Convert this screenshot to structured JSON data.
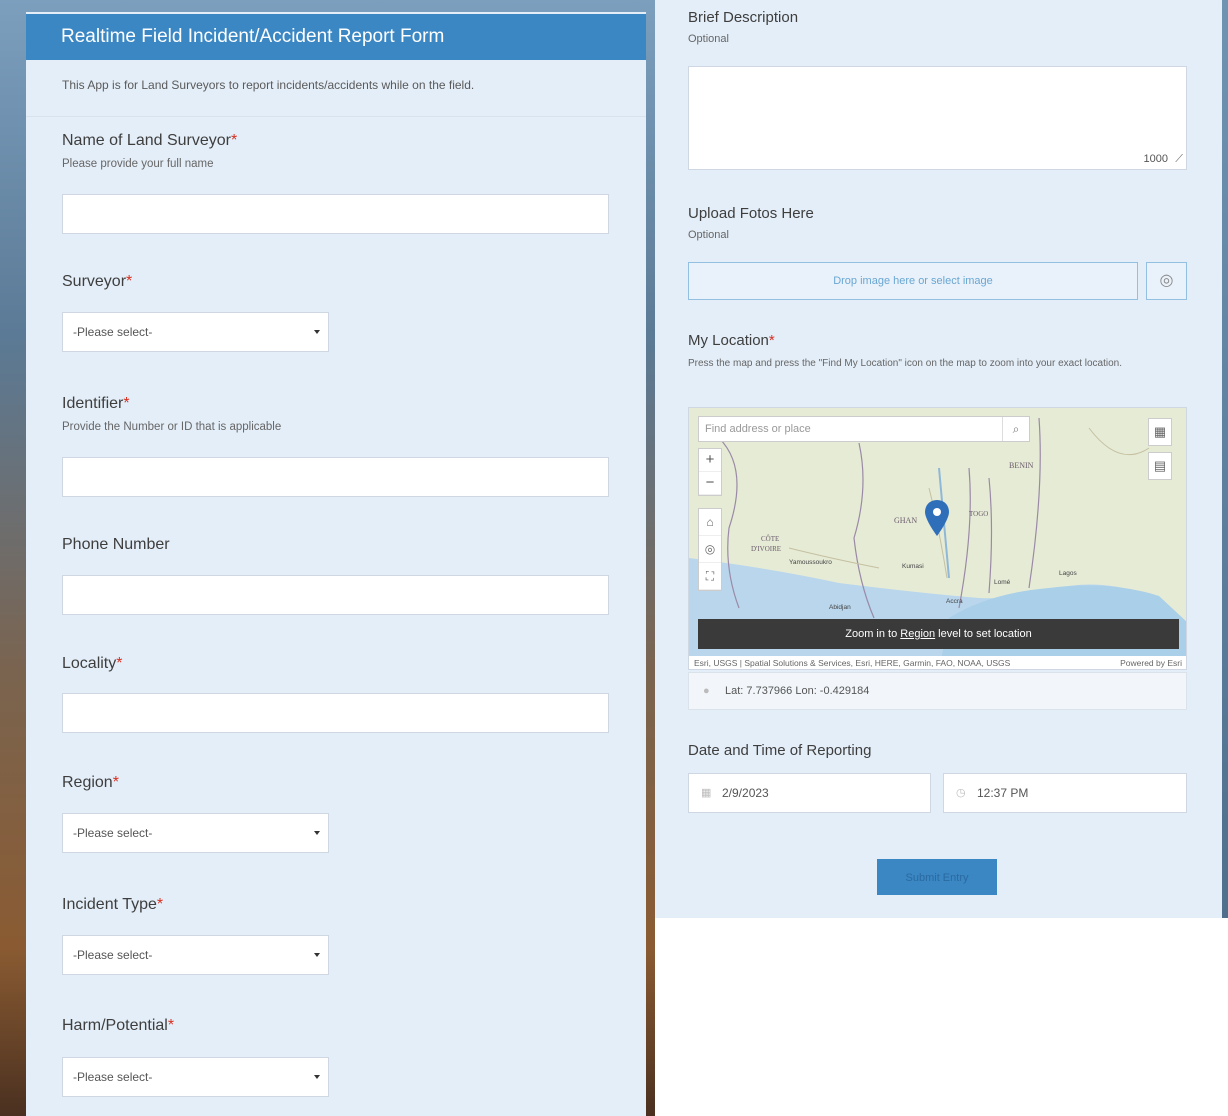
{
  "form": {
    "title": "Realtime Field Incident/Accident Report Form",
    "description": "This App is for Land Surveyors to report incidents/accidents while on the field."
  },
  "fields": {
    "name": {
      "label": "Name of Land Surveyor",
      "required": "*",
      "hint": "Please provide your full name",
      "value": ""
    },
    "surveyor": {
      "label": "Surveyor",
      "required": "*",
      "selected": "-Please select-"
    },
    "identifier": {
      "label": "Identifier",
      "required": "*",
      "hint": "Provide the Number or ID that is applicable",
      "value": ""
    },
    "phone": {
      "label": "Phone Number",
      "value": ""
    },
    "locality": {
      "label": "Locality",
      "required": "*",
      "value": ""
    },
    "region": {
      "label": "Region",
      "required": "*",
      "selected": "-Please select-"
    },
    "incident_type": {
      "label": "Incident Type",
      "required": "*",
      "selected": "-Please select-"
    },
    "harm": {
      "label": "Harm/Potential",
      "required": "*",
      "selected": "-Please select-"
    },
    "description": {
      "label": "Brief Description",
      "hint": "Optional",
      "counter": "1000"
    },
    "photos": {
      "label": "Upload Fotos Here",
      "hint": "Optional",
      "dropzone": "Drop image here or select image"
    },
    "location": {
      "label": "My Location",
      "required": "*",
      "hint": "Press the map and press the \"Find My Location\" icon on the map to zoom into your exact location.",
      "search_placeholder": "Find address or place",
      "banner_pre": "Zoom in to ",
      "banner_link": "Region",
      "banner_post": " level to set location",
      "attribution_left": "Esri, USGS | Spatial Solutions & Services, Esri, HERE, Garmin, FAO, NOAA, USGS",
      "attribution_right": "Powered by Esri",
      "coords": "Lat: 7.737966  Lon: -0.429184",
      "map_labels": {
        "benin": "BENIN",
        "togo": "TOGO",
        "ghana": "GHAN",
        "cote": "CÔTE",
        "divoire": "D'IVOIRE",
        "yamoussoukro": "Yamoussoukro",
        "kumasi": "Kumasi",
        "lome": "Lomé",
        "lagos": "Lagos",
        "abidjan": "Abidjan",
        "accra": "Accra"
      }
    },
    "datetime": {
      "label": "Date and Time of Reporting",
      "date": "2/9/2023",
      "time": "12:37 PM"
    }
  },
  "submit_label": "Submit Entry"
}
